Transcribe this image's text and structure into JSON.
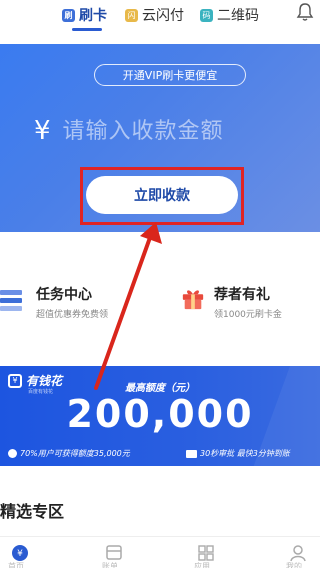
{
  "top_tabs": [
    {
      "icon": "card-tab-icon",
      "icon_glyph": "刷",
      "label": "刷卡"
    },
    {
      "icon": "flash-pay-icon",
      "icon_glyph": "闪",
      "label": "云闪付"
    },
    {
      "icon": "qrcode-icon",
      "icon_glyph": "码",
      "label": "二维码"
    }
  ],
  "card": {
    "vip_text": "开通VIP刷卡更便宜",
    "currency_symbol": "¥",
    "amount_placeholder": "请输入收款金额",
    "collect_label": "立即收款"
  },
  "features": [
    {
      "title": "任务中心",
      "subtitle": "超值优惠券免费领"
    },
    {
      "title": "荐者有礼",
      "subtitle": "领1000元刷卡金"
    }
  ],
  "banner": {
    "logo_name": "有钱花",
    "logo_sub": "百度有钱花",
    "limit_label": "最高额度（元）",
    "amount": "200,000",
    "foot_left": "70%用户可获得额度35,000元",
    "foot_right": "30秒审批  最快3分钟到账"
  },
  "section_title": "精选专区",
  "bottom_nav": [
    {
      "icon": "home-icon",
      "label": "首页"
    },
    {
      "icon": "bill-icon",
      "label": "账单"
    },
    {
      "icon": "apps-icon",
      "label": "应用"
    },
    {
      "icon": "profile-icon",
      "label": "我的"
    }
  ],
  "colors": {
    "brand_blue": "#2a5bd1",
    "card_gradient_start": "#3a7bf0",
    "highlight_red": "#e02424"
  }
}
